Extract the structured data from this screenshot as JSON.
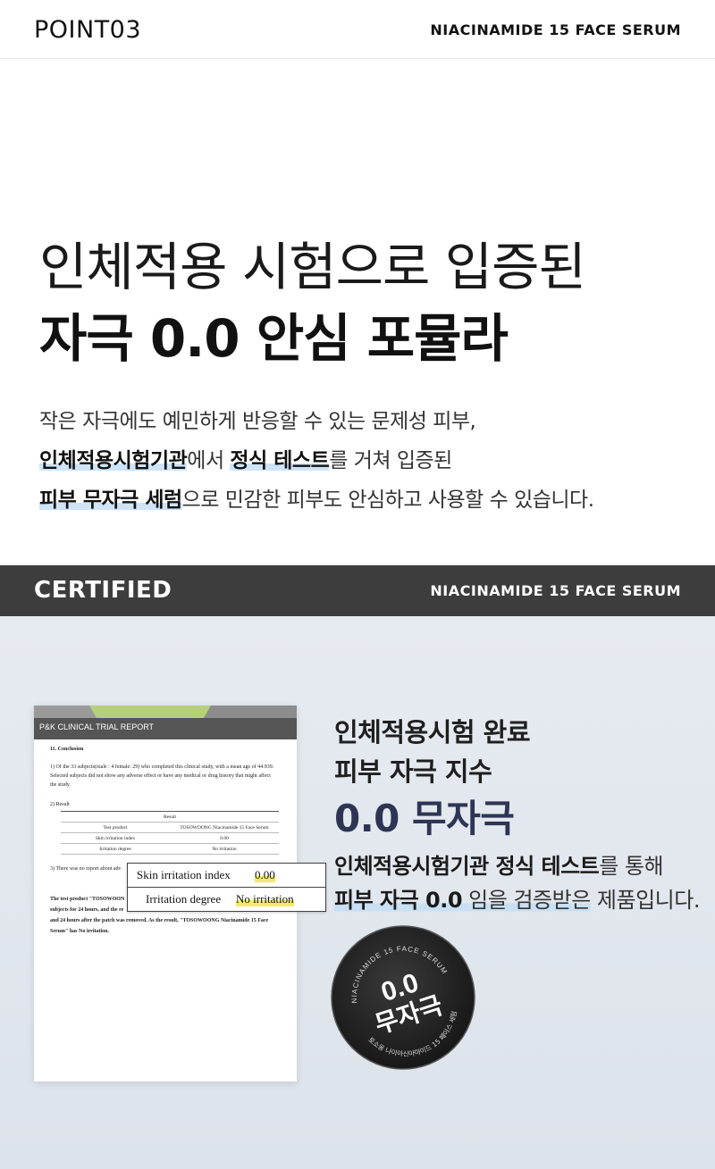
{
  "header": {
    "point_label": "POINT03",
    "product_name": "NIACINAMIDE 15 FACE SERUM"
  },
  "headline": {
    "line1": "인체적용 시험으로 입증된",
    "line2": "자극 0.0 안심 포뮬라"
  },
  "description": {
    "line1": "작은 자극에도 예민하게 반응할 수 있는 문제성 피부,",
    "line2_bold1": "인체적용시험기관",
    "line2_mid": "에서 ",
    "line2_bold2": "정식 테스트",
    "line2_end": "를 거쳐 입증된",
    "line3_bold": "피부 무자극 세럼",
    "line3_end": "으로 민감한 피부도 안심하고 사용할 수 있습니다."
  },
  "certified": {
    "label": "CERTIFIED",
    "product_name": "NIACINAMIDE 15 FACE SERUM"
  },
  "report": {
    "band_title": "P&K CLINICAL TRIAL REPORT",
    "section": "11. Conclusion",
    "p1_l1": "1) Of the 33 subjects(male : 4 female: 29) who completed this clinical study, with a mean age of 44.939.",
    "p1_l2": "Selected subjects did not show any adverse effect or have any medical or drug history that might affect",
    "p1_l3": "the study.",
    "p2": "2) Result",
    "table_header": "Result",
    "row1_k": "Test product",
    "row1_v": "TOSOWOONG Niacinamide 15 Face Serum",
    "row2_k": "Skin irritation index",
    "row2_v": "0.00",
    "row3_k": "Irritation degree",
    "row3_v": "No irritation",
    "p3": "3) There was no report about adv",
    "p4_l1": "The test product \"TOSOWOON",
    "p4_l2": "subjects for 24 hours, and the re",
    "p4_l3": "and 24 hours after the patch was removed. As the result, \"TOSOWOONG Niacinamide 15 Face",
    "p4_l4": "Serum\" has No irritation."
  },
  "zoom": {
    "k1": "Skin irritation index",
    "v1": "0.00",
    "k2": "Irritation degree",
    "v2": "No irritation"
  },
  "right": {
    "t1": "인체적용시험 완료",
    "t2": "피부 자극 지수",
    "t3": "0.0 무자극",
    "s1_bold": "인체적용시험기관 정식 테스트",
    "s1_end": "를 통해",
    "s2_bold": "피부 자극 0.0",
    "s2_mid": " 임을 검증받은",
    "s2_end": " 제품입니다."
  },
  "badge": {
    "arc_top": "NIACINAMIDE 15 FACE SERUM",
    "arc_bottom": "토소웅 나이아신아마이드 15 페이스 세럼",
    "value": "0.0",
    "text": "무자극"
  },
  "colors": {
    "dark_bar": "#3d3d3d",
    "accent_navy": "#2e3554",
    "highlight_blue": "#cfe4f7",
    "highlight_yellow": "#f5e96a"
  }
}
